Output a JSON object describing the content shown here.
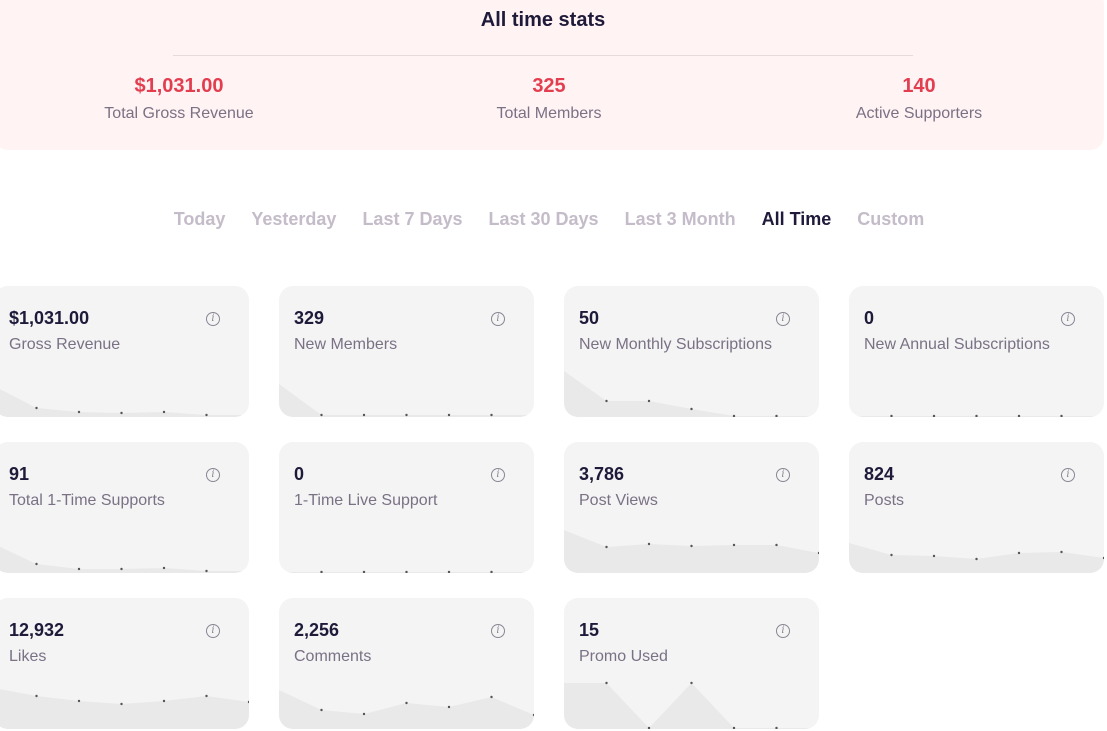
{
  "summary": {
    "title": "All time stats",
    "stats": [
      {
        "value": "$1,031.00",
        "label": "Total Gross Revenue"
      },
      {
        "value": "325",
        "label": "Total Members"
      },
      {
        "value": "140",
        "label": "Active Supporters"
      }
    ]
  },
  "filters": [
    "Today",
    "Yesterday",
    "Last 7 Days",
    "Last 30 Days",
    "Last 3 Month",
    "All Time",
    "Custom"
  ],
  "active_filter": "All Time",
  "cards": [
    {
      "value": "$1,031.00",
      "label": "Gross Revenue",
      "trend": [
        30,
        8,
        4,
        3,
        4,
        1,
        1
      ]
    },
    {
      "value": "329",
      "label": "New Members",
      "trend": [
        32,
        1,
        1,
        1,
        1,
        1,
        1
      ]
    },
    {
      "value": "50",
      "label": "New Monthly Subscriptions",
      "trend": [
        45,
        15,
        15,
        7,
        0,
        0,
        0
      ]
    },
    {
      "value": "0",
      "label": "New Annual Subscriptions",
      "trend": [
        0,
        0,
        0,
        0,
        0,
        0,
        0
      ]
    },
    {
      "value": "91",
      "label": "Total 1-Time Supports",
      "trend": [
        28,
        8,
        3,
        3,
        4,
        1,
        1
      ]
    },
    {
      "value": "0",
      "label": "1-Time Live Support",
      "trend": [
        0,
        0,
        0,
        0,
        0,
        0,
        0
      ]
    },
    {
      "value": "3,786",
      "label": "Post Views",
      "trend": [
        42,
        25,
        28,
        26,
        27,
        27,
        19
      ]
    },
    {
      "value": "824",
      "label": "Posts",
      "trend": [
        29,
        17,
        16,
        13,
        19,
        20,
        14
      ]
    },
    {
      "value": "12,932",
      "label": "Likes",
      "trend": [
        40,
        32,
        27,
        24,
        27,
        32,
        26
      ]
    },
    {
      "value": "2,256",
      "label": "Comments",
      "trend": [
        38,
        18,
        14,
        25,
        21,
        31,
        13
      ]
    },
    {
      "value": "15",
      "label": "Promo Used",
      "trend": [
        45,
        45,
        0,
        45,
        0,
        0,
        0
      ]
    }
  ],
  "info_icon": "info-icon",
  "colors": {
    "accent": "#e23e50",
    "dark_text": "#1d1a3a",
    "muted_text": "#7a7185",
    "summary_bg": "#fff3f3",
    "card_bg": "#f4f4f4",
    "sparkline_fill": "#e9e9e9",
    "inactive_filter": "#c4bcc9"
  }
}
